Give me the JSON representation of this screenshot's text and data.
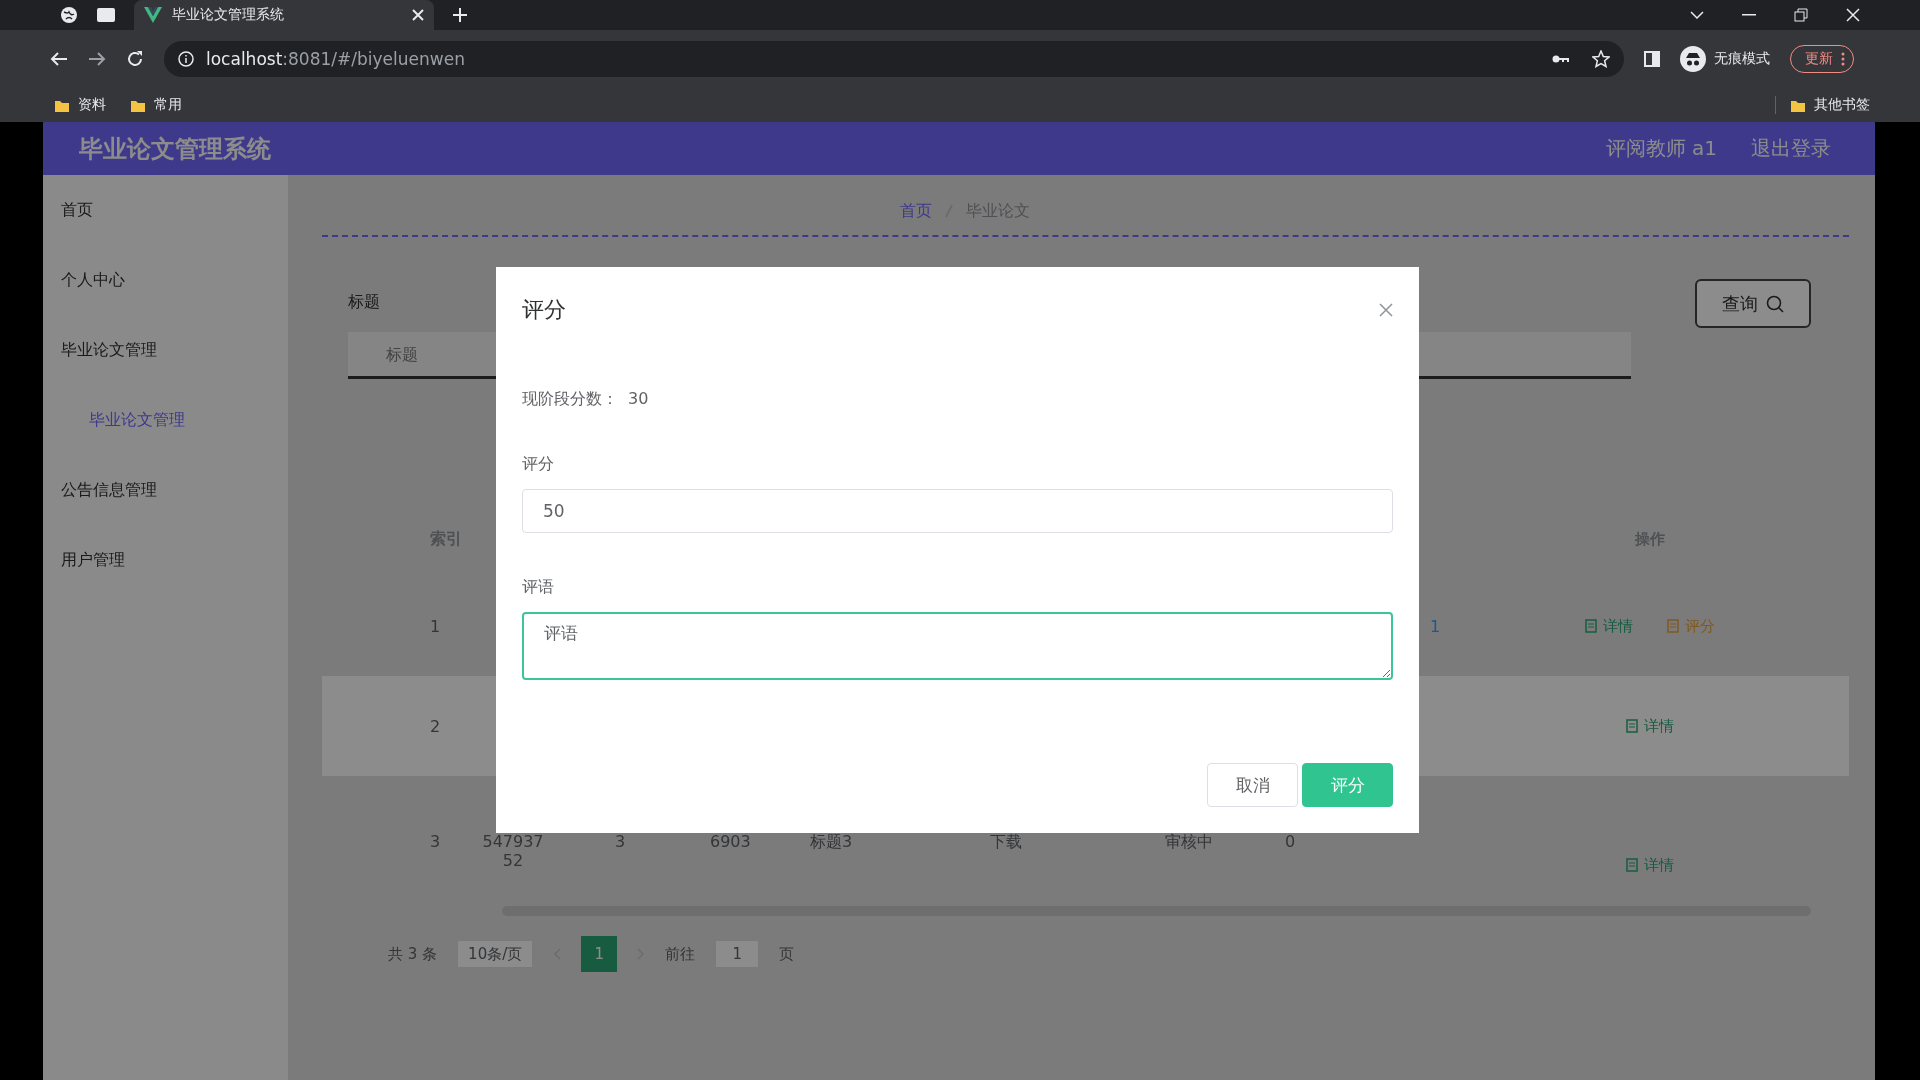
{
  "browser": {
    "tab": {
      "title": "毕业论文管理系统"
    },
    "address": {
      "host": "localhost",
      "path": ":8081/#/biyeluenwen"
    },
    "profile_label": "无痕模式",
    "update_button": "更新",
    "bookmarks": [
      {
        "label": "资料"
      },
      {
        "label": "常用"
      }
    ],
    "other_bookmarks": "其他书签"
  },
  "header": {
    "title": "毕业论文管理系统",
    "user": "评阅教师 a1",
    "logout": "退出登录"
  },
  "sidebar": {
    "items": [
      {
        "label": "首页",
        "selected": false
      },
      {
        "label": "个人中心",
        "selected": false
      },
      {
        "label": "毕业论文管理",
        "selected": false,
        "children": [
          {
            "label": "毕业论文管理",
            "selected": true
          }
        ]
      },
      {
        "label": "公告信息管理",
        "selected": false
      },
      {
        "label": "用户管理",
        "selected": false
      }
    ]
  },
  "breadcrumb": [
    {
      "label": "首页",
      "current": false
    },
    {
      "label": "毕业论文",
      "current": true
    }
  ],
  "search": {
    "label": "标题",
    "placeholder": "标题",
    "button": "查询"
  },
  "table": {
    "header": {
      "column_1": "索引",
      "column_10": "操作"
    },
    "rows": [
      {
        "hovered": false,
        "cells": {
          "column_1": "1",
          "column_9": "1"
        },
        "actions": [
          {
            "label": "详情",
            "kind": "detail"
          },
          {
            "label": "评分",
            "kind": "grade"
          }
        ]
      },
      {
        "hovered": true,
        "cells": {
          "column_1": "2"
        },
        "actions": [
          {
            "label": "详情",
            "kind": "detail"
          }
        ]
      },
      {
        "hovered": false,
        "cells": {
          "column_1": "3",
          "column_2": "54793752",
          "column_3": "3",
          "column_4": "6903",
          "column_5": "标题3",
          "column_6": "下载",
          "column_7": "审核中",
          "column_8": "0"
        },
        "actions": [
          {
            "label": "详情",
            "kind": "detail"
          }
        ]
      }
    ]
  },
  "pagination": {
    "total": "共 3 条",
    "page_size": "10条/页",
    "pages": [
      {
        "label": "1",
        "selected": true
      }
    ],
    "goto_label": "前往",
    "goto_value": "1",
    "goto_suffix": "页"
  },
  "dialog": {
    "title": "评分",
    "current_score_label": "现阶段分数：",
    "current_score": "30",
    "fields": [
      {
        "label": "评分",
        "kind": "input",
        "value": "50",
        "focused": false
      },
      {
        "label": "评语",
        "kind": "textarea",
        "value": "评语",
        "focused": true
      }
    ],
    "buttons": [
      {
        "label": "取消",
        "kind": "default"
      },
      {
        "label": "评分",
        "kind": "primary"
      }
    ]
  }
}
